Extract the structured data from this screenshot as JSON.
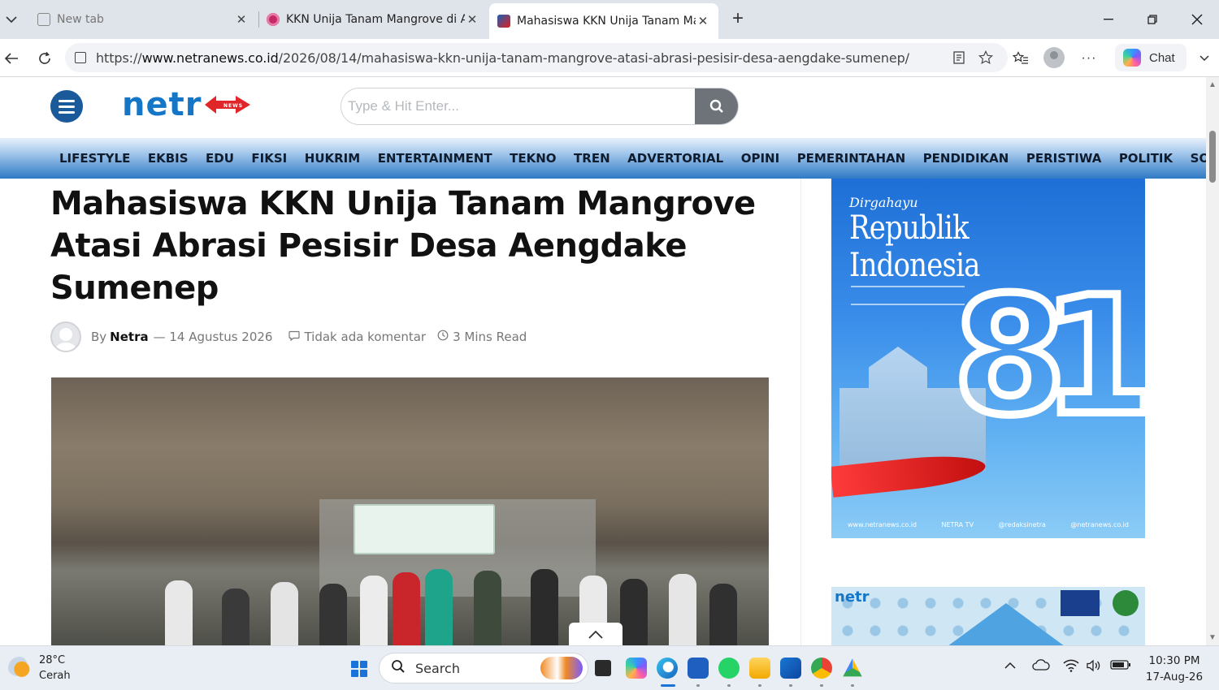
{
  "browser": {
    "tabs": [
      {
        "label": "New tab"
      },
      {
        "label": "KKN Unija Tanam Mangrove di Aer"
      },
      {
        "label": "Mahasiswa KKN Unija Tanam Mang"
      }
    ],
    "url_prefix": "https://",
    "url_host": "www.netranews.co.id",
    "url_path": "/2026/08/14/mahasiswa-kkn-unija-tanam-mangrove-atasi-abrasi-pesisir-desa-aengdake-sumenep/",
    "chat_label": "Chat"
  },
  "site": {
    "logo_text": "netr",
    "logo_sub": "NEWS",
    "search_placeholder": "Type & Hit Enter...",
    "categories": [
      "LIFESTYLE",
      "EKBIS",
      "EDU",
      "FIKSI",
      "HUKRIM",
      "ENTERTAINMENT",
      "TEKNO",
      "TREN",
      "ADVERTORIAL",
      "OPINI",
      "PEMERINTAHAN",
      "PENDIDIKAN",
      "PERISTIWA",
      "POLITIK",
      "SO"
    ]
  },
  "article": {
    "title": "Mahasiswa KKN Unija Tanam Mangrove Atasi Abrasi Pesisir Desa Aengdake Sumenep",
    "by_label": "By",
    "author": "Netra",
    "date": "— 14 Agustus 2026",
    "comments": "Tidak ada komentar",
    "read_time": "3 Mins Read"
  },
  "sidebar": {
    "ad1_script": "Dirgahayu",
    "ad1_line1": "Republik",
    "ad1_line2": "Indonesia",
    "ad1_number": "81",
    "ad1_footer": [
      "www.netranews.co.id",
      "NETRA TV",
      "@redaksinetra",
      "@netranews.co.id"
    ],
    "ad2_logo": "netr"
  },
  "taskbar": {
    "temperature": "28°C",
    "weather": "Cerah",
    "search_label": "Search",
    "time": "10:30 PM",
    "date": "17-Aug-26"
  }
}
